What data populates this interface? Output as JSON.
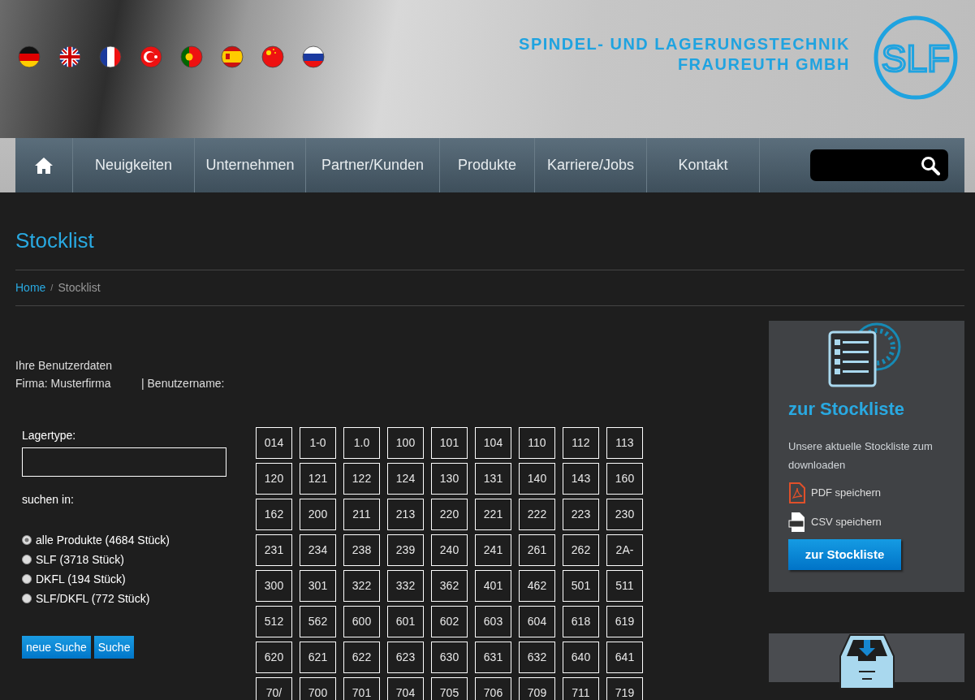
{
  "languages": [
    {
      "kind": "de"
    },
    {
      "kind": "gb"
    },
    {
      "kind": "fr"
    },
    {
      "kind": "tr"
    },
    {
      "kind": "pt"
    },
    {
      "kind": "es"
    },
    {
      "kind": "cn"
    },
    {
      "kind": "ru"
    }
  ],
  "company": {
    "line1": "SPINDEL- UND LAGERUNGSTECHNIK",
    "line2": "FRAUREUTH GMBH",
    "logo": "SLF"
  },
  "nav": {
    "items": [
      "Neuigkeiten",
      "Unternehmen",
      "Partner/Kunden",
      "Produkte",
      "Karriere/Jobs",
      "Kontakt"
    ]
  },
  "page_title": "Stocklist",
  "breadcrumb": {
    "separator": "/",
    "items": [
      {
        "label": "Home",
        "current": false
      },
      {
        "label": "Stocklist",
        "current": true
      }
    ]
  },
  "user_data": {
    "heading": "Ihre Benutzerdaten",
    "company": "Firma: Musterfirma",
    "username": "| Benutzername:"
  },
  "search_form": {
    "type_label": "Lagertype:",
    "scope_label": "suchen in:",
    "options": [
      {
        "label": "alle Produkte (4684 Stück)",
        "selected": true
      },
      {
        "label": "SLF (3718 Stück)",
        "selected": false
      },
      {
        "label": "DKFL (194 Stück)",
        "selected": false
      },
      {
        "label": "SLF/DKFL (772 Stück)",
        "selected": false
      }
    ],
    "buttons": [
      "neue Suche",
      "Suche"
    ]
  },
  "prefixes": [
    "014",
    "1-0",
    "1.0",
    "100",
    "101",
    "104",
    "110",
    "112",
    "113",
    "120",
    "121",
    "122",
    "124",
    "130",
    "131",
    "140",
    "143",
    "160",
    "162",
    "200",
    "211",
    "213",
    "220",
    "221",
    "222",
    "223",
    "230",
    "231",
    "234",
    "238",
    "239",
    "240",
    "241",
    "261",
    "262",
    "2A-",
    "300",
    "301",
    "322",
    "332",
    "362",
    "401",
    "462",
    "501",
    "511",
    "512",
    "562",
    "600",
    "601",
    "602",
    "603",
    "604",
    "618",
    "619",
    "620",
    "621",
    "622",
    "623",
    "630",
    "631",
    "632",
    "640",
    "641",
    "70/",
    "700",
    "701",
    "704",
    "705",
    "706",
    "709",
    "711",
    "719"
  ],
  "stocklist_card": {
    "title": "zur Stockliste",
    "text": "Unsere aktuelle Stockliste zum downloaden",
    "downloads": [
      {
        "kind": "pdf",
        "label": "PDF speichern"
      },
      {
        "kind": "csv",
        "label": "CSV speichern"
      }
    ],
    "button": "zur Stockliste"
  }
}
